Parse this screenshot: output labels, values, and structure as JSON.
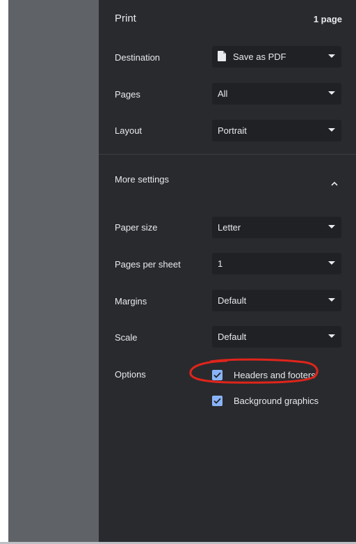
{
  "header": {
    "title": "Print",
    "page_count": "1 page"
  },
  "settings": {
    "destination": {
      "label": "Destination",
      "value": "Save as PDF",
      "icon": "document-icon"
    },
    "pages": {
      "label": "Pages",
      "value": "All"
    },
    "layout": {
      "label": "Layout",
      "value": "Portrait"
    }
  },
  "more_settings": {
    "label": "More settings",
    "expanded": true
  },
  "advanced": {
    "paper_size": {
      "label": "Paper size",
      "value": "Letter"
    },
    "pages_per_sheet": {
      "label": "Pages per sheet",
      "value": "1"
    },
    "margins": {
      "label": "Margins",
      "value": "Default"
    },
    "scale": {
      "label": "Scale",
      "value": "Default"
    }
  },
  "options": {
    "label": "Options",
    "headers_footers": {
      "label": "Headers and footers",
      "checked": true
    },
    "background_graphics": {
      "label": "Background graphics",
      "checked": true
    }
  },
  "colors": {
    "panel_bg": "#292a2d",
    "select_bg": "#202124",
    "preview_bg": "#5f6368",
    "checkbox": "#8ab4f8",
    "annotation": "#e0241b"
  }
}
